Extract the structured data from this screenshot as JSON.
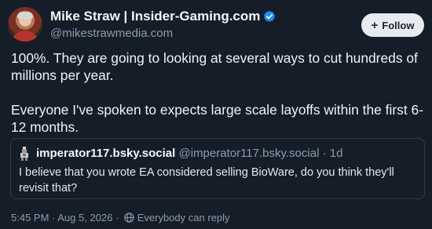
{
  "author": {
    "name": "Mike Straw | Insider-Gaming.com",
    "handle": "@mikestrawmedia.com",
    "verified_icon": "verified-check-icon",
    "accent_color": "#1d8cf8"
  },
  "follow_button": {
    "icon": "plus-icon",
    "label": "Follow"
  },
  "post": {
    "paragraphs": [
      "100%. They are going to looking at several ways to cut hundreds of millions per year.",
      "Everyone I've spoken to expects large scale layoffs within the first 6-12 months."
    ]
  },
  "quote": {
    "name": "imperator117.bsky.social",
    "handle": "@imperator117.bsky.social",
    "separator": "·",
    "age": "1d",
    "text": "I believe that you wrote EA considered selling BioWare, do you think they'll revisit that?"
  },
  "meta": {
    "timestamp": "5:45 PM · Aug 5, 2026",
    "separator": "·",
    "reply_icon": "globe-icon",
    "reply_setting": "Everybody can reply"
  },
  "colors": {
    "background": "#151d28",
    "muted_text": "#8e9bab",
    "border": "#2f3a49"
  }
}
